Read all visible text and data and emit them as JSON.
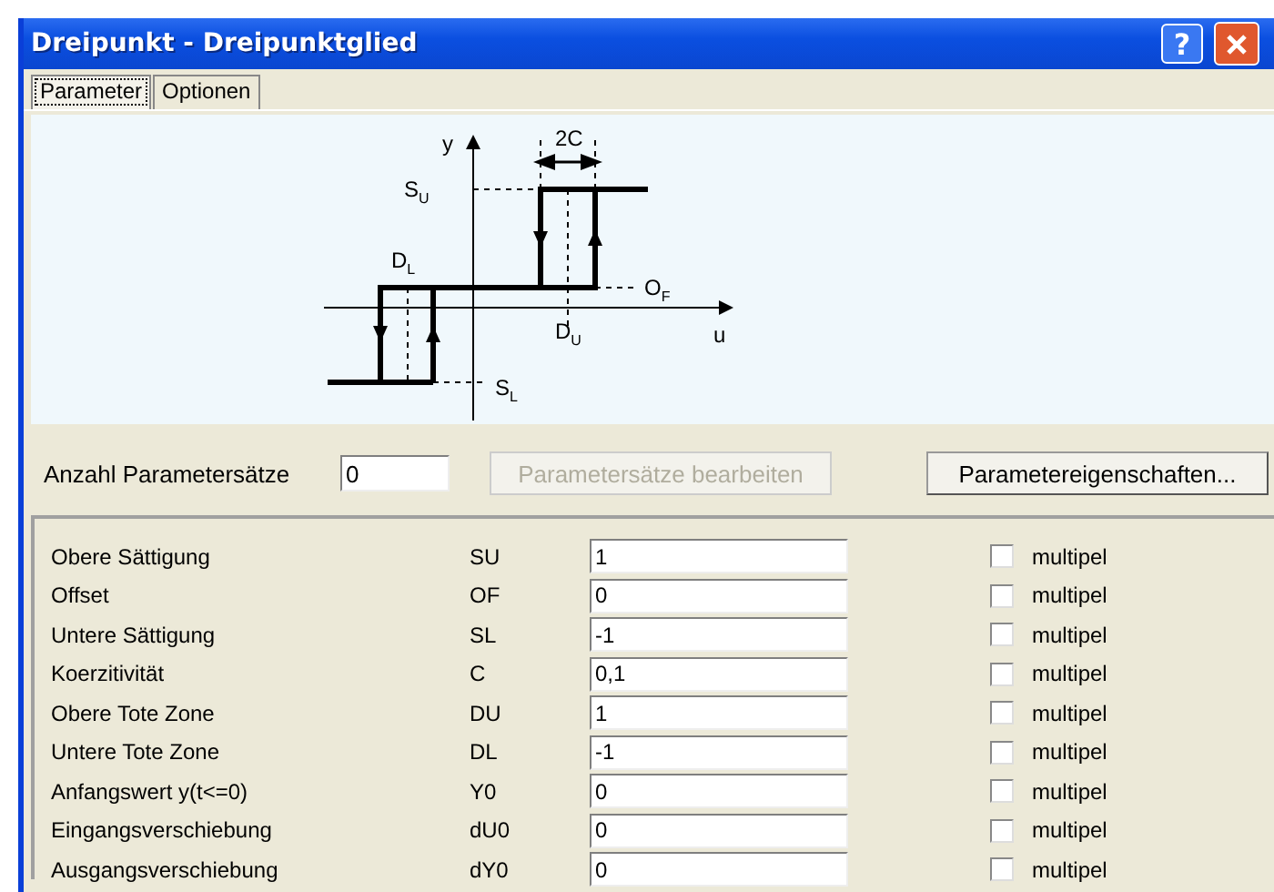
{
  "window": {
    "title": "Dreipunkt - Dreipunktglied",
    "help_button": "?"
  },
  "tabs": [
    {
      "label": "Parameter",
      "selected": true
    },
    {
      "label": "Optionen",
      "selected": false
    }
  ],
  "diagram_labels": [
    {
      "kind": "y",
      "text": "y"
    },
    {
      "kind": "width",
      "text": "2C"
    },
    {
      "kind": "su",
      "text": "S$_{U}$"
    },
    {
      "kind": "dl",
      "text": "D$_{L}$"
    },
    {
      "kind": "of",
      "text": "O$_{F}$"
    },
    {
      "kind": "du",
      "text": "D$_{U}$"
    },
    {
      "kind": "u",
      "text": "u"
    },
    {
      "kind": "sl",
      "text": "S$_{L}$"
    }
  ],
  "parameter_sets": {
    "label": "Anzahl Parametersätze",
    "value": "0"
  },
  "buttons": [
    {
      "label": "Parametersätze bearbeiten",
      "disabled": true
    },
    {
      "label": "Parametereigenschaften...",
      "disabled": false
    }
  ],
  "parameters": [
    {
      "name": "Obere Sättigung",
      "symbol": "SU",
      "value": "1",
      "multiple": {
        "label": "multipel",
        "checked": false
      }
    },
    {
      "name": "Offset",
      "symbol": "OF",
      "value": "0",
      "multiple": {
        "label": "multipel",
        "checked": false
      }
    },
    {
      "name": "Untere Sättigung",
      "symbol": "SL",
      "value": "-1",
      "multiple": {
        "label": "multipel",
        "checked": false
      }
    },
    {
      "name": "Koerzitivität",
      "symbol": "C",
      "value": "0,1",
      "multiple": {
        "label": "multipel",
        "checked": false
      }
    },
    {
      "name": "Obere Tote Zone",
      "symbol": "DU",
      "value": "1",
      "multiple": {
        "label": "multipel",
        "checked": false
      }
    },
    {
      "name": "Untere Tote Zone",
      "symbol": "DL",
      "value": "-1",
      "multiple": {
        "label": "multipel",
        "checked": false
      }
    },
    {
      "name": "Anfangswert y(t<=0)",
      "symbol": "Y0",
      "value": "0",
      "multiple": {
        "label": "multipel",
        "checked": false
      }
    },
    {
      "name": "Eingangsverschiebung",
      "symbol": "dU0",
      "value": "0",
      "multiple": {
        "label": "multipel",
        "checked": false
      }
    },
    {
      "name": "Ausgangsverschiebung",
      "symbol": "dY0",
      "value": "0",
      "multiple": {
        "label": "multipel",
        "checked": false
      }
    }
  ]
}
